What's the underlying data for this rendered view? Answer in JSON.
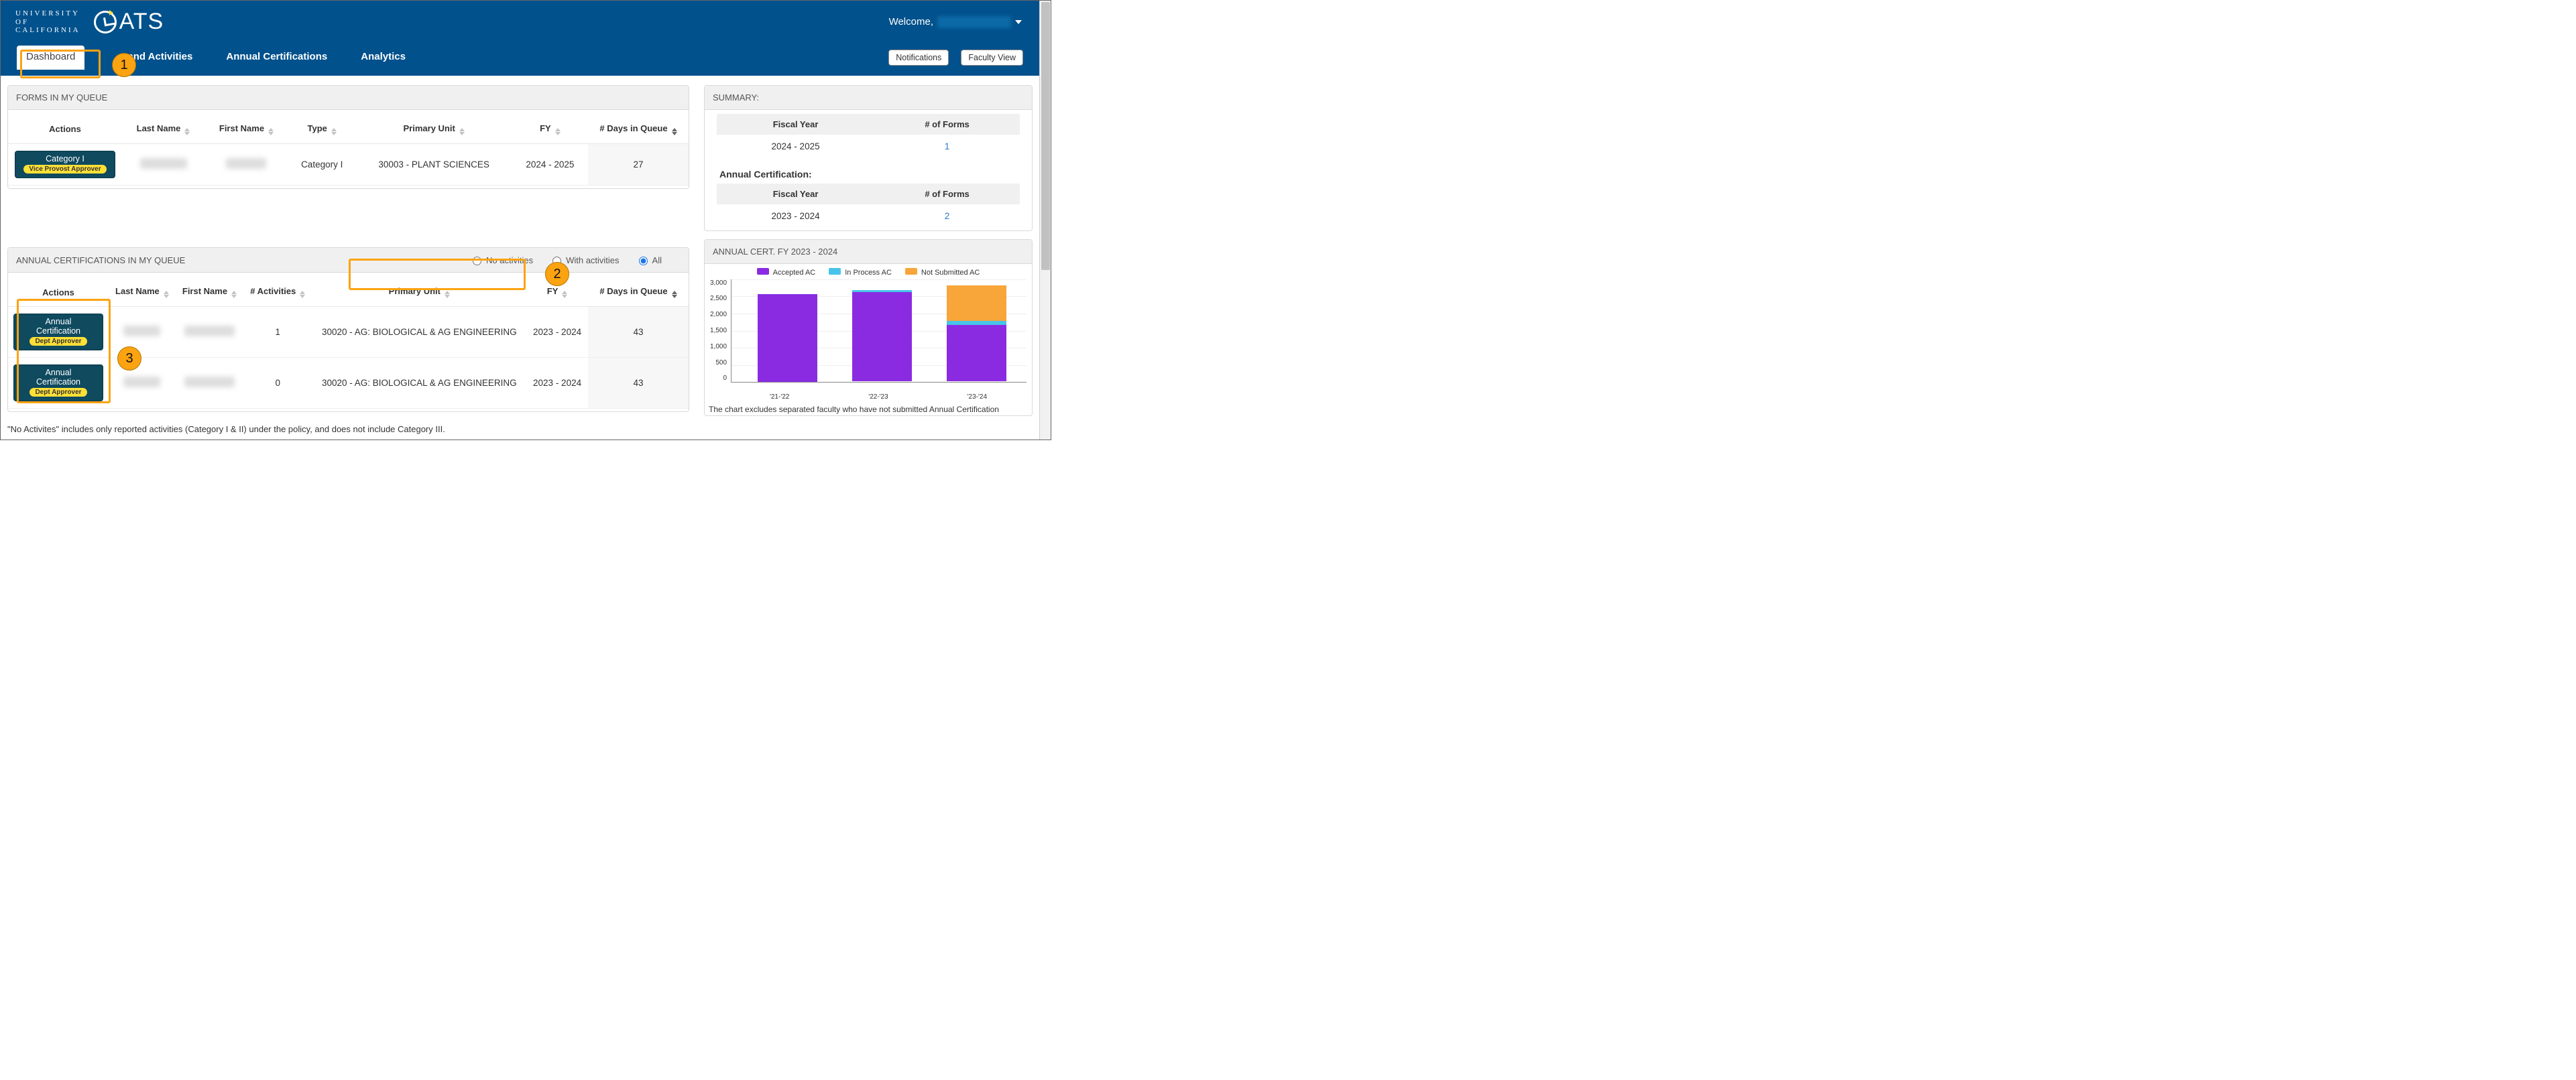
{
  "header": {
    "uc_text": "UNIVERSITY<br>OF<br>CALIFORNIA",
    "oats_text": "ATS",
    "welcome": "Welcome,",
    "notifications": "Notifications",
    "faculty_view": "Faculty View"
  },
  "nav": {
    "dashboard": "Dashboard",
    "forms_activities": "and Activities",
    "annual_cert": "Annual Certifications",
    "analytics": "Analytics"
  },
  "queue": {
    "title": "FORMS IN MY QUEUE",
    "cols": {
      "actions": "Actions",
      "last": "Last Name",
      "first": "First Name",
      "type": "Type",
      "unit": "Primary Unit",
      "fy": "FY",
      "days": "# Days in Queue"
    },
    "rows": [
      {
        "action_top": "Category I",
        "action_chip": "Vice Provost Approver",
        "type": "Category I",
        "unit": "30003 - PLANT SCIENCES",
        "fy": "2024 - 2025",
        "days": "27"
      }
    ]
  },
  "ac_queue": {
    "title": "ANNUAL CERTIFICATIONS IN MY QUEUE",
    "filters": {
      "none": "No activities",
      "with": "With activities",
      "all": "All",
      "selected": "all"
    },
    "cols": {
      "actions": "Actions",
      "last": "Last Name",
      "first": "First Name",
      "acts": "# Activities",
      "unit": "Primary Unit",
      "fy": "FY",
      "days": "# Days in Queue"
    },
    "rows": [
      {
        "action_top": "Annual Certification",
        "action_chip": "Dept Approver",
        "acts": "1",
        "unit": "30020 - AG: BIOLOGICAL & AG ENGINEERING",
        "fy": "2023 - 2024",
        "days": "43"
      },
      {
        "action_top": "Annual Certification",
        "action_chip": "Dept Approver",
        "acts": "0",
        "unit": "30020 - AG: BIOLOGICAL & AG ENGINEERING",
        "fy": "2023 - 2024",
        "days": "43"
      }
    ],
    "footnote": "\"No Activites\" includes only reported activities (Category I & II) under the policy, and does not include Category III."
  },
  "summary": {
    "title": "SUMMARY:",
    "cols": {
      "fy": "Fiscal Year",
      "forms": "# of Forms"
    },
    "forms_rows": [
      {
        "fy": "2024 - 2025",
        "n": "1"
      }
    ],
    "ac_label": "Annual Certification:",
    "ac_rows": [
      {
        "fy": "2023 - 2024",
        "n": "2"
      }
    ]
  },
  "chart_data": {
    "title": "ANNUAL CERT. FY 2023 - 2024",
    "type": "bar",
    "stacked": true,
    "categories": [
      "'21-'22",
      "'22-'23",
      "'23-'24"
    ],
    "series": [
      {
        "name": "Accepted AC",
        "color": "#8a2be2",
        "values": [
          2550,
          2600,
          1650
        ]
      },
      {
        "name": "In Process AC",
        "color": "#48c4e9",
        "values": [
          0,
          50,
          120
        ]
      },
      {
        "name": "Not Submitted AC",
        "color": "#f8a53a",
        "values": [
          0,
          0,
          1030
        ]
      }
    ],
    "ylabel": "",
    "xlabel": "",
    "ylim": [
      0,
      3000
    ],
    "yticks": [
      0,
      500,
      1000,
      1500,
      2000,
      2500,
      3000
    ],
    "footnote": "The chart excludes separated faculty who have not submitted Annual Certification"
  },
  "annotations": {
    "one": "1",
    "two": "2",
    "three": "3"
  }
}
